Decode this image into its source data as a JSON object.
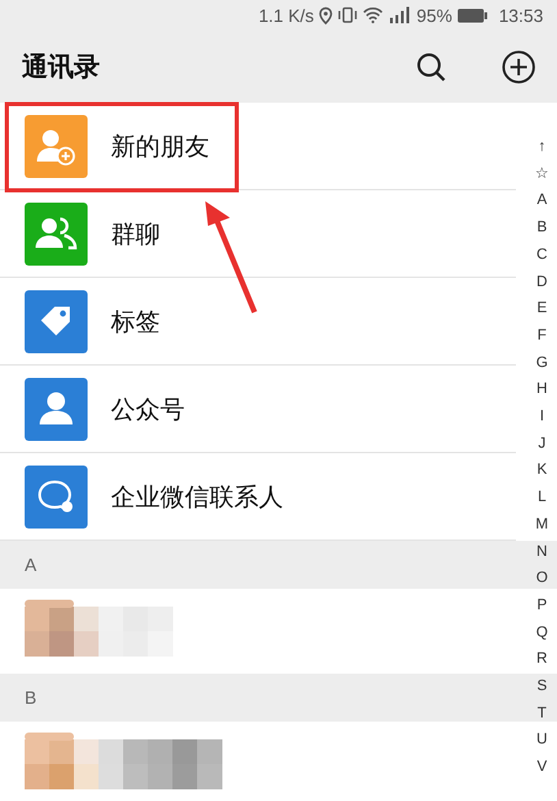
{
  "status_bar": {
    "speed": "1.1 K/s",
    "battery": "95%",
    "time": "13:53"
  },
  "header": {
    "title": "通讯录"
  },
  "entries": [
    {
      "kind": "new-friend",
      "label": "新的朋友",
      "color": "#f79c32"
    },
    {
      "kind": "group",
      "label": "群聊",
      "color": "#1aad19"
    },
    {
      "kind": "tag",
      "label": "标签",
      "color": "#2b7fd6"
    },
    {
      "kind": "official",
      "label": "公众号",
      "color": "#2b7fd6"
    },
    {
      "kind": "work",
      "label": "企业微信联系人",
      "color": "#2b7fd6"
    }
  ],
  "sections": [
    {
      "letter": "A"
    },
    {
      "letter": "B"
    }
  ],
  "index": [
    "↑",
    "☆",
    "A",
    "B",
    "C",
    "D",
    "E",
    "F",
    "G",
    "H",
    "I",
    "J",
    "K",
    "L",
    "M",
    "N",
    "O",
    "P",
    "Q",
    "R",
    "S",
    "T",
    "U",
    "V"
  ]
}
